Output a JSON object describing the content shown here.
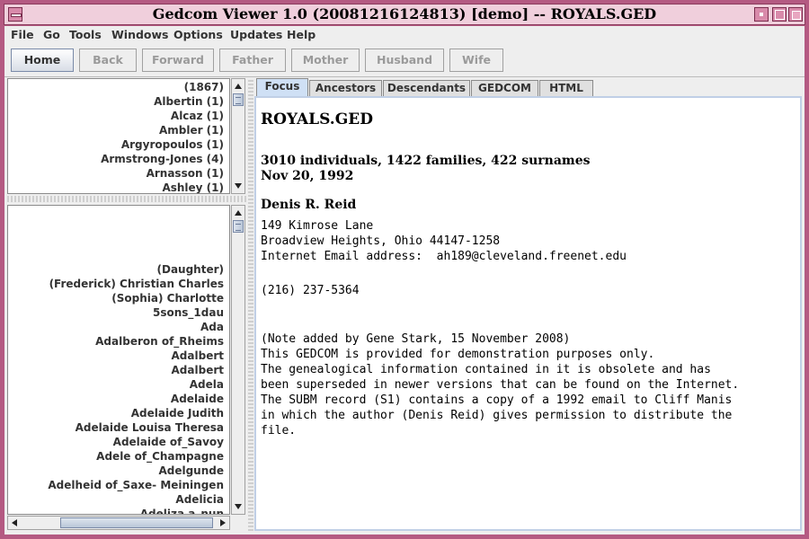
{
  "window": {
    "title": "Gedcom Viewer 1.0 (20081216124813) [demo] -- ROYALS.GED"
  },
  "menu": [
    "File",
    "Go",
    "Tools",
    "Windows",
    "Options",
    "Updates",
    "Help"
  ],
  "toolbar": {
    "buttons": [
      "Home",
      "Back",
      "Forward",
      "Father",
      "Mother",
      "Husband",
      "Wife"
    ],
    "active": "Home"
  },
  "surnames": [
    "(1867)",
    "Albertin (1)",
    "Alcaz (1)",
    "Ambler (1)",
    "Argyropoulos (1)",
    "Armstrong-Jones (4)",
    "Arnasson (1)",
    "Ashley (1)"
  ],
  "names": [
    "(Daughter)",
    "(Frederick) Christian Charles",
    "(Sophia) Charlotte",
    "5sons_1dau",
    "Ada",
    "Adalberon of_Rheims",
    "Adalbert",
    "Adalbert",
    "Adela",
    "Adelaide",
    "Adelaide Judith",
    "Adelaide Louisa Theresa",
    "Adelaide of_Savoy",
    "Adele of_Champagne",
    "Adelgunde",
    "Adelheid of_Saxe- Meiningen",
    "Adelicia",
    "Adeliza a_nun"
  ],
  "tabs": [
    "Focus",
    "Ancestors",
    "Descendants",
    "GEDCOM",
    "HTML"
  ],
  "activeTab": "Focus",
  "focus": {
    "file": "ROYALS.GED",
    "stats": "3010 individuals, 1422 families, 422 surnames",
    "date": "Nov 20, 1992",
    "author": "Denis R. Reid",
    "address": "149 Kimrose Lane\nBroadview Heights, Ohio 44147-1258\nInternet Email address:  ah189@cleveland.freenet.edu",
    "phone": "(216) 237-5364",
    "note": "(Note added by Gene Stark, 15 November 2008)\nThis GEDCOM is provided for demonstration purposes only.\nThe genealogical information contained in it is obsolete and has\nbeen superseded in newer versions that can be found on the Internet.\nThe SUBM record (S1) contains a copy of a 1992 email to Cliff Manis\nin which the author (Denis Reid) gives permission to distribute the\nfile."
  }
}
